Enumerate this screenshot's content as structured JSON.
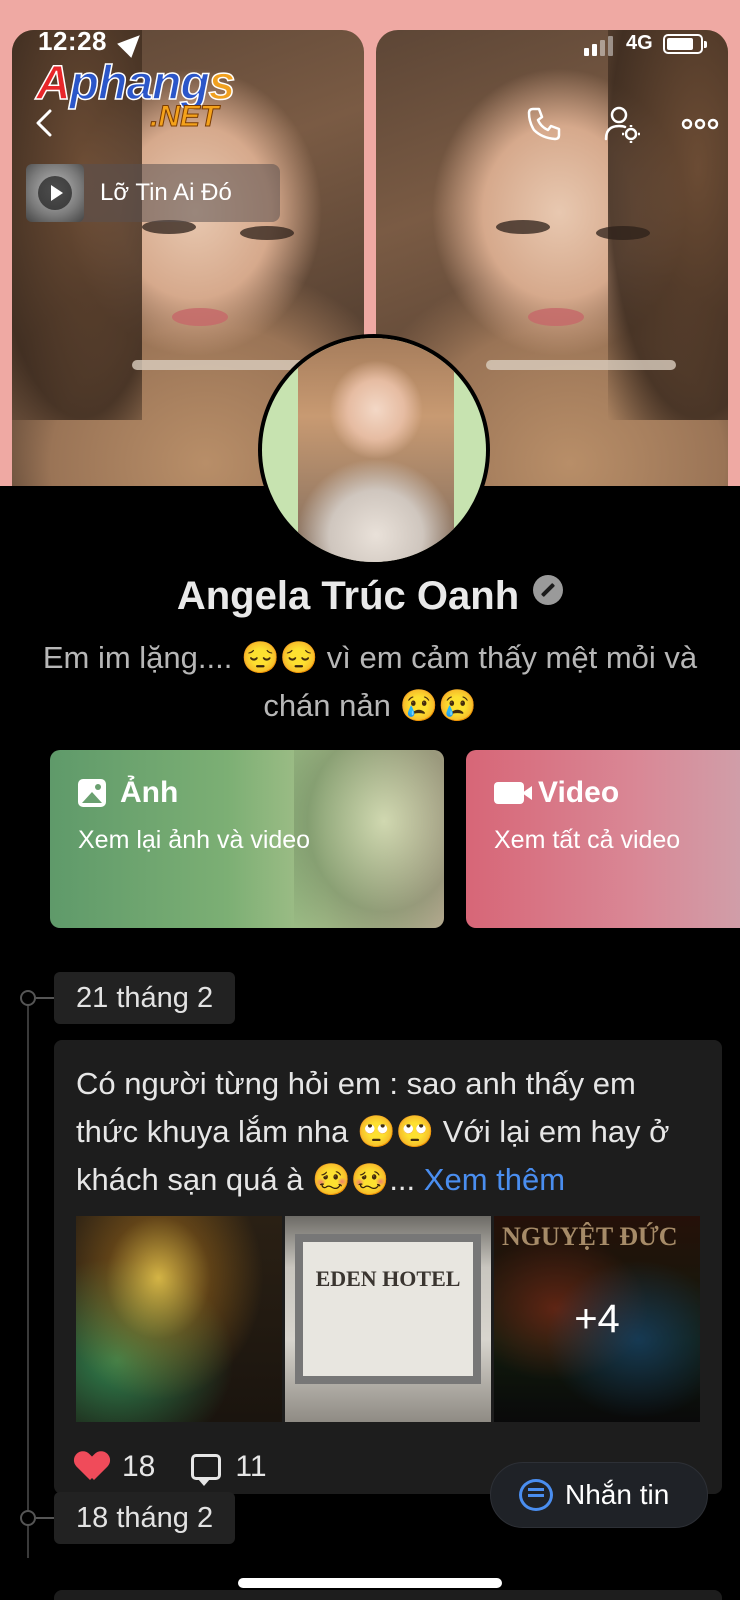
{
  "status_bar": {
    "time": "12:28",
    "network": "4G"
  },
  "watermark": {
    "brand": "Aphangs",
    "tld": ".NET"
  },
  "profile_header": {
    "music": {
      "title": "Lỡ Tin Ai Đó"
    },
    "icons": [
      "back-icon",
      "phone-icon",
      "user-settings-icon",
      "more-icon"
    ]
  },
  "profile": {
    "name": "Angela Trúc Oanh",
    "bio": "Em im lặng.... 😔😔 vì em cảm thấy mệt mỏi và chán nản 😢😢"
  },
  "album_cards": [
    {
      "title": "Ảnh",
      "subtitle": "Xem lại ảnh và video",
      "icon": "image-icon"
    },
    {
      "title": "Video",
      "subtitle": "Xem tất cả video",
      "icon": "video-camera-icon"
    }
  ],
  "timeline": {
    "posts": [
      {
        "date": "21 tháng 2",
        "text": "Có người từng hỏi em : sao anh thấy em thức khuya lắm nha 🙄🙄 Với lại em hay ở khách sạn quá à 🥴🥴...",
        "see_more": "Xem thêm",
        "image_labels": {
          "hotel_sign": "EDEN HOTEL",
          "hotel_name": "NGUYỆT ĐỨC"
        },
        "extra_images": "+4",
        "likes": "18",
        "comments": "11"
      },
      {
        "date": "18 tháng 2"
      }
    ]
  },
  "fab": {
    "label": "Nhắn tin"
  },
  "colors": {
    "accent": "#4a8ef0",
    "heart": "#f04b5a",
    "background": "#000000"
  }
}
